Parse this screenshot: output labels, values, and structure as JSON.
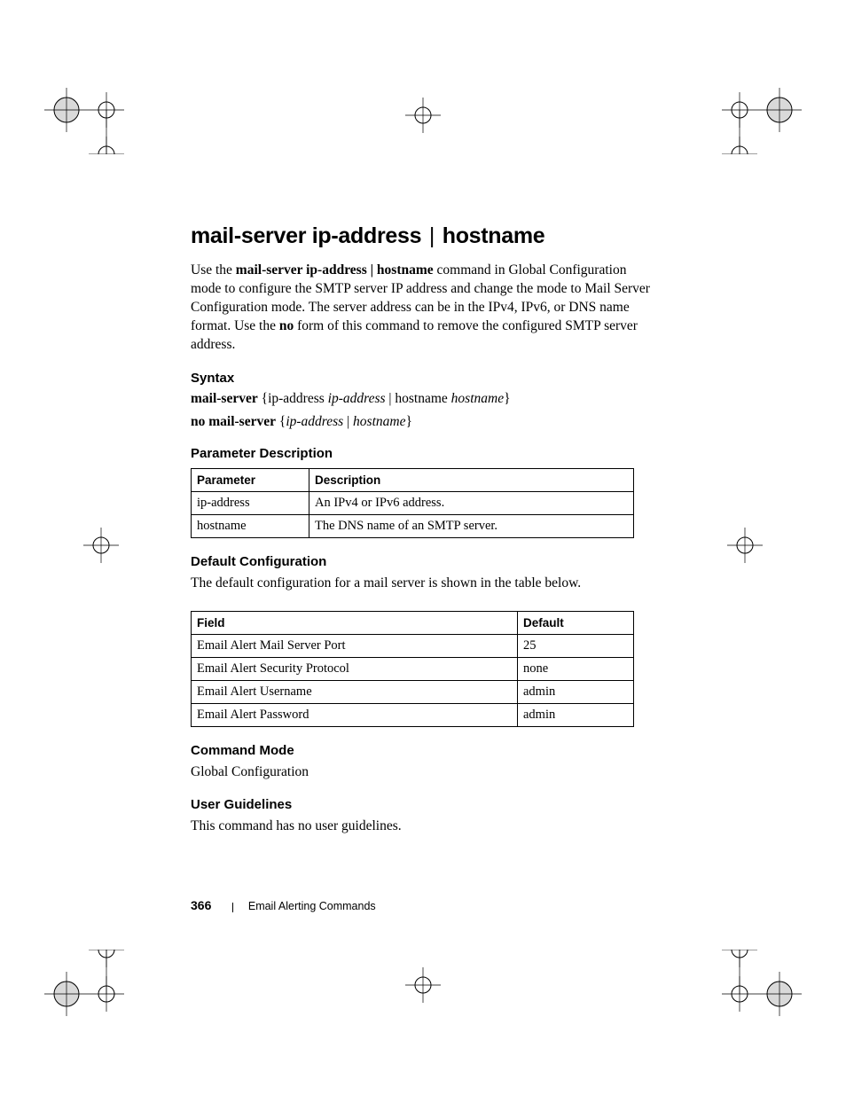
{
  "title_part1": "mail-server ip-address",
  "title_pipe": "|",
  "title_part2": "hostname",
  "intro": {
    "pre": "Use the ",
    "bold1": "mail-server ip-address | hostname",
    "mid1": " command in Global Configuration mode to configure the SMTP server IP address and change the mode to Mail Server Configuration mode. The server address can be in the IPv4, IPv6, or DNS name format. Use the ",
    "bold2": "no",
    "post": " form of this command to remove the configured SMTP server address."
  },
  "syntax_heading": "Syntax",
  "syntax_line1": {
    "b1": "mail-server",
    "t1": " {ip-address ",
    "i1": "ip-address",
    "t2": " | hostname ",
    "i2": "hostname",
    "t3": "}"
  },
  "syntax_line2": {
    "b1": "no mail-server",
    "t1": " {",
    "i1": "ip-address",
    "t2": " |  ",
    "i2": "hostname",
    "t3": "}"
  },
  "param_desc_heading": "Parameter Description",
  "param_table": {
    "h1": "Parameter",
    "h2": "Description",
    "rows": [
      {
        "p": "ip-address",
        "d": "An IPv4 or IPv6 address."
      },
      {
        "p": "hostname",
        "d": "The DNS name of an SMTP server."
      }
    ]
  },
  "default_heading": "Default Configuration",
  "default_text": "The default configuration for a mail server is shown in the table below.",
  "default_table": {
    "h1": "Field",
    "h2": "Default",
    "rows": [
      {
        "f": "Email Alert Mail Server Port",
        "d": "25"
      },
      {
        "f": "Email Alert Security Protocol",
        "d": "none"
      },
      {
        "f": "Email Alert Username",
        "d": "admin"
      },
      {
        "f": "Email Alert Password",
        "d": "admin"
      }
    ]
  },
  "cmd_mode_heading": "Command Mode",
  "cmd_mode_text": "Global Configuration",
  "user_guide_heading": "User Guidelines",
  "user_guide_text": "This command has no user guidelines.",
  "footer": {
    "page": "366",
    "chapter": "Email Alerting Commands"
  }
}
